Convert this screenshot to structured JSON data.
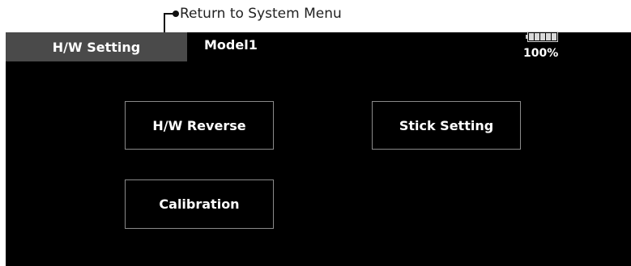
{
  "callout": {
    "text": "Return to System Menu"
  },
  "header": {
    "title": "H/W Setting",
    "model": "Model1",
    "battery_percent": "100%",
    "battery_level": 1.0
  },
  "buttons": {
    "hw_reverse": "H/W Reverse",
    "stick_setting": "Stick Setting",
    "calibration": "Calibration"
  },
  "colors": {
    "screen_bg": "#000000",
    "tab_bg": "#4a4a4a",
    "button_border": "#8a8a8a",
    "text": "#ffffff"
  },
  "icons": {
    "battery": "battery-icon"
  }
}
